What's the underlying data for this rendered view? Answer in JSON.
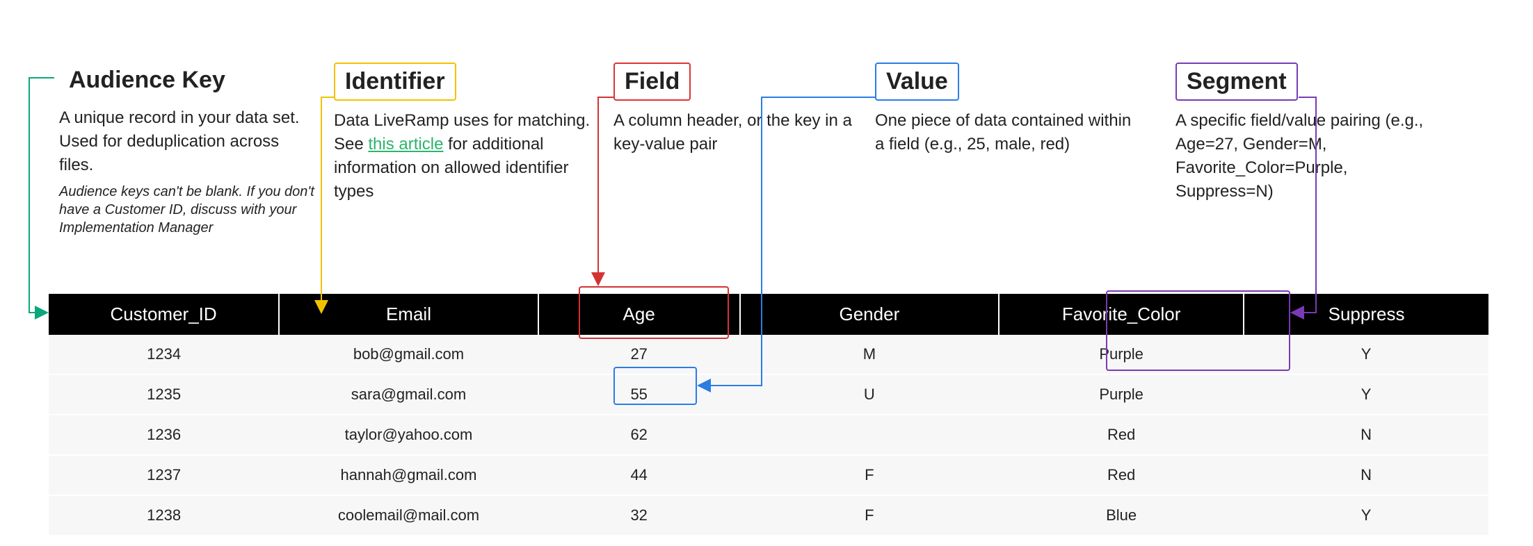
{
  "annotations": {
    "audience_key": {
      "title": "Audience Key",
      "desc": "A unique record in your data set. Used for deduplication across files.",
      "fineprint": "Audience keys can't be blank.\nIf you don't have a Customer ID, discuss with your Implementation Manager"
    },
    "identifier": {
      "title": "Identifier",
      "desc_pre": "Data LiveRamp uses for matching. See ",
      "link_text": "this article",
      "desc_post": " for additional information on allowed identifier types"
    },
    "field": {
      "title": "Field",
      "desc": "A column header, or the key in a key-value pair"
    },
    "value": {
      "title": "Value",
      "desc": "One piece of data contained within a field (e.g., 25, male, red)"
    },
    "segment": {
      "title": "Segment",
      "desc": "A specific field/value pairing (e.g., Age=27, Gender=M, Favorite_Color=Purple, Suppress=N)"
    }
  },
  "columns": [
    "Customer_ID",
    "Email",
    "Age",
    "Gender",
    "Favorite_Color",
    "Suppress"
  ],
  "rows": [
    {
      "Customer_ID": "1234",
      "Email": "bob@gmail.com",
      "Age": "27",
      "Gender": "M",
      "Favorite_Color": "Purple",
      "Suppress": "Y"
    },
    {
      "Customer_ID": "1235",
      "Email": "sara@gmail.com",
      "Age": "55",
      "Gender": "U",
      "Favorite_Color": "Purple",
      "Suppress": "Y"
    },
    {
      "Customer_ID": "1236",
      "Email": "taylor@yahoo.com",
      "Age": "62",
      "Gender": "",
      "Favorite_Color": "Red",
      "Suppress": "N"
    },
    {
      "Customer_ID": "1237",
      "Email": "hannah@gmail.com",
      "Age": "44",
      "Gender": "F",
      "Favorite_Color": "Red",
      "Suppress": "N"
    },
    {
      "Customer_ID": "1238",
      "Email": "coolemail@mail.com",
      "Age": "32",
      "Gender": "F",
      "Favorite_Color": "Blue",
      "Suppress": "Y"
    }
  ],
  "colors": {
    "audience_key": "#0aa77a",
    "identifier": "#f2c200",
    "field": "#d33333",
    "value": "#2a7de1",
    "segment": "#7a3ab5"
  }
}
